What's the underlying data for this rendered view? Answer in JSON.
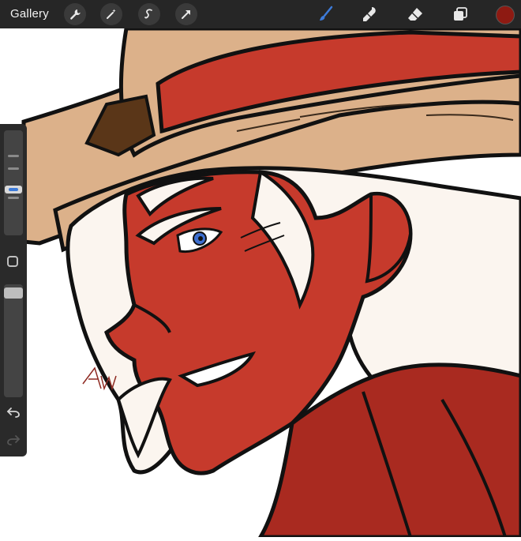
{
  "toolbar": {
    "gallery_label": "Gallery",
    "left_icons": [
      "wrench-icon",
      "magic-wand-icon",
      "selection-icon",
      "transform-arrow-icon"
    ],
    "right_icons": [
      "brush-icon",
      "smudge-icon",
      "eraser-icon",
      "layers-icon"
    ],
    "active_tool": "brush",
    "active_color": "#8e1a12",
    "accent_color": "#3d7bd9"
  },
  "sidebar": {
    "brush_size_level": 0.55,
    "opacity_level": 1.0,
    "icons": [
      "modify-square-icon",
      "undo-icon",
      "redo-icon"
    ]
  },
  "canvas": {
    "palette": {
      "skin": "#c63a2c",
      "skin_shadow": "#a92a20",
      "hat": "#dcb18a",
      "hat_band": "#c63a2c",
      "hat_buckle": "#5a3618",
      "hair": "#fbf5ef",
      "eye": "#3d6fd0",
      "outline": "#111111"
    }
  }
}
